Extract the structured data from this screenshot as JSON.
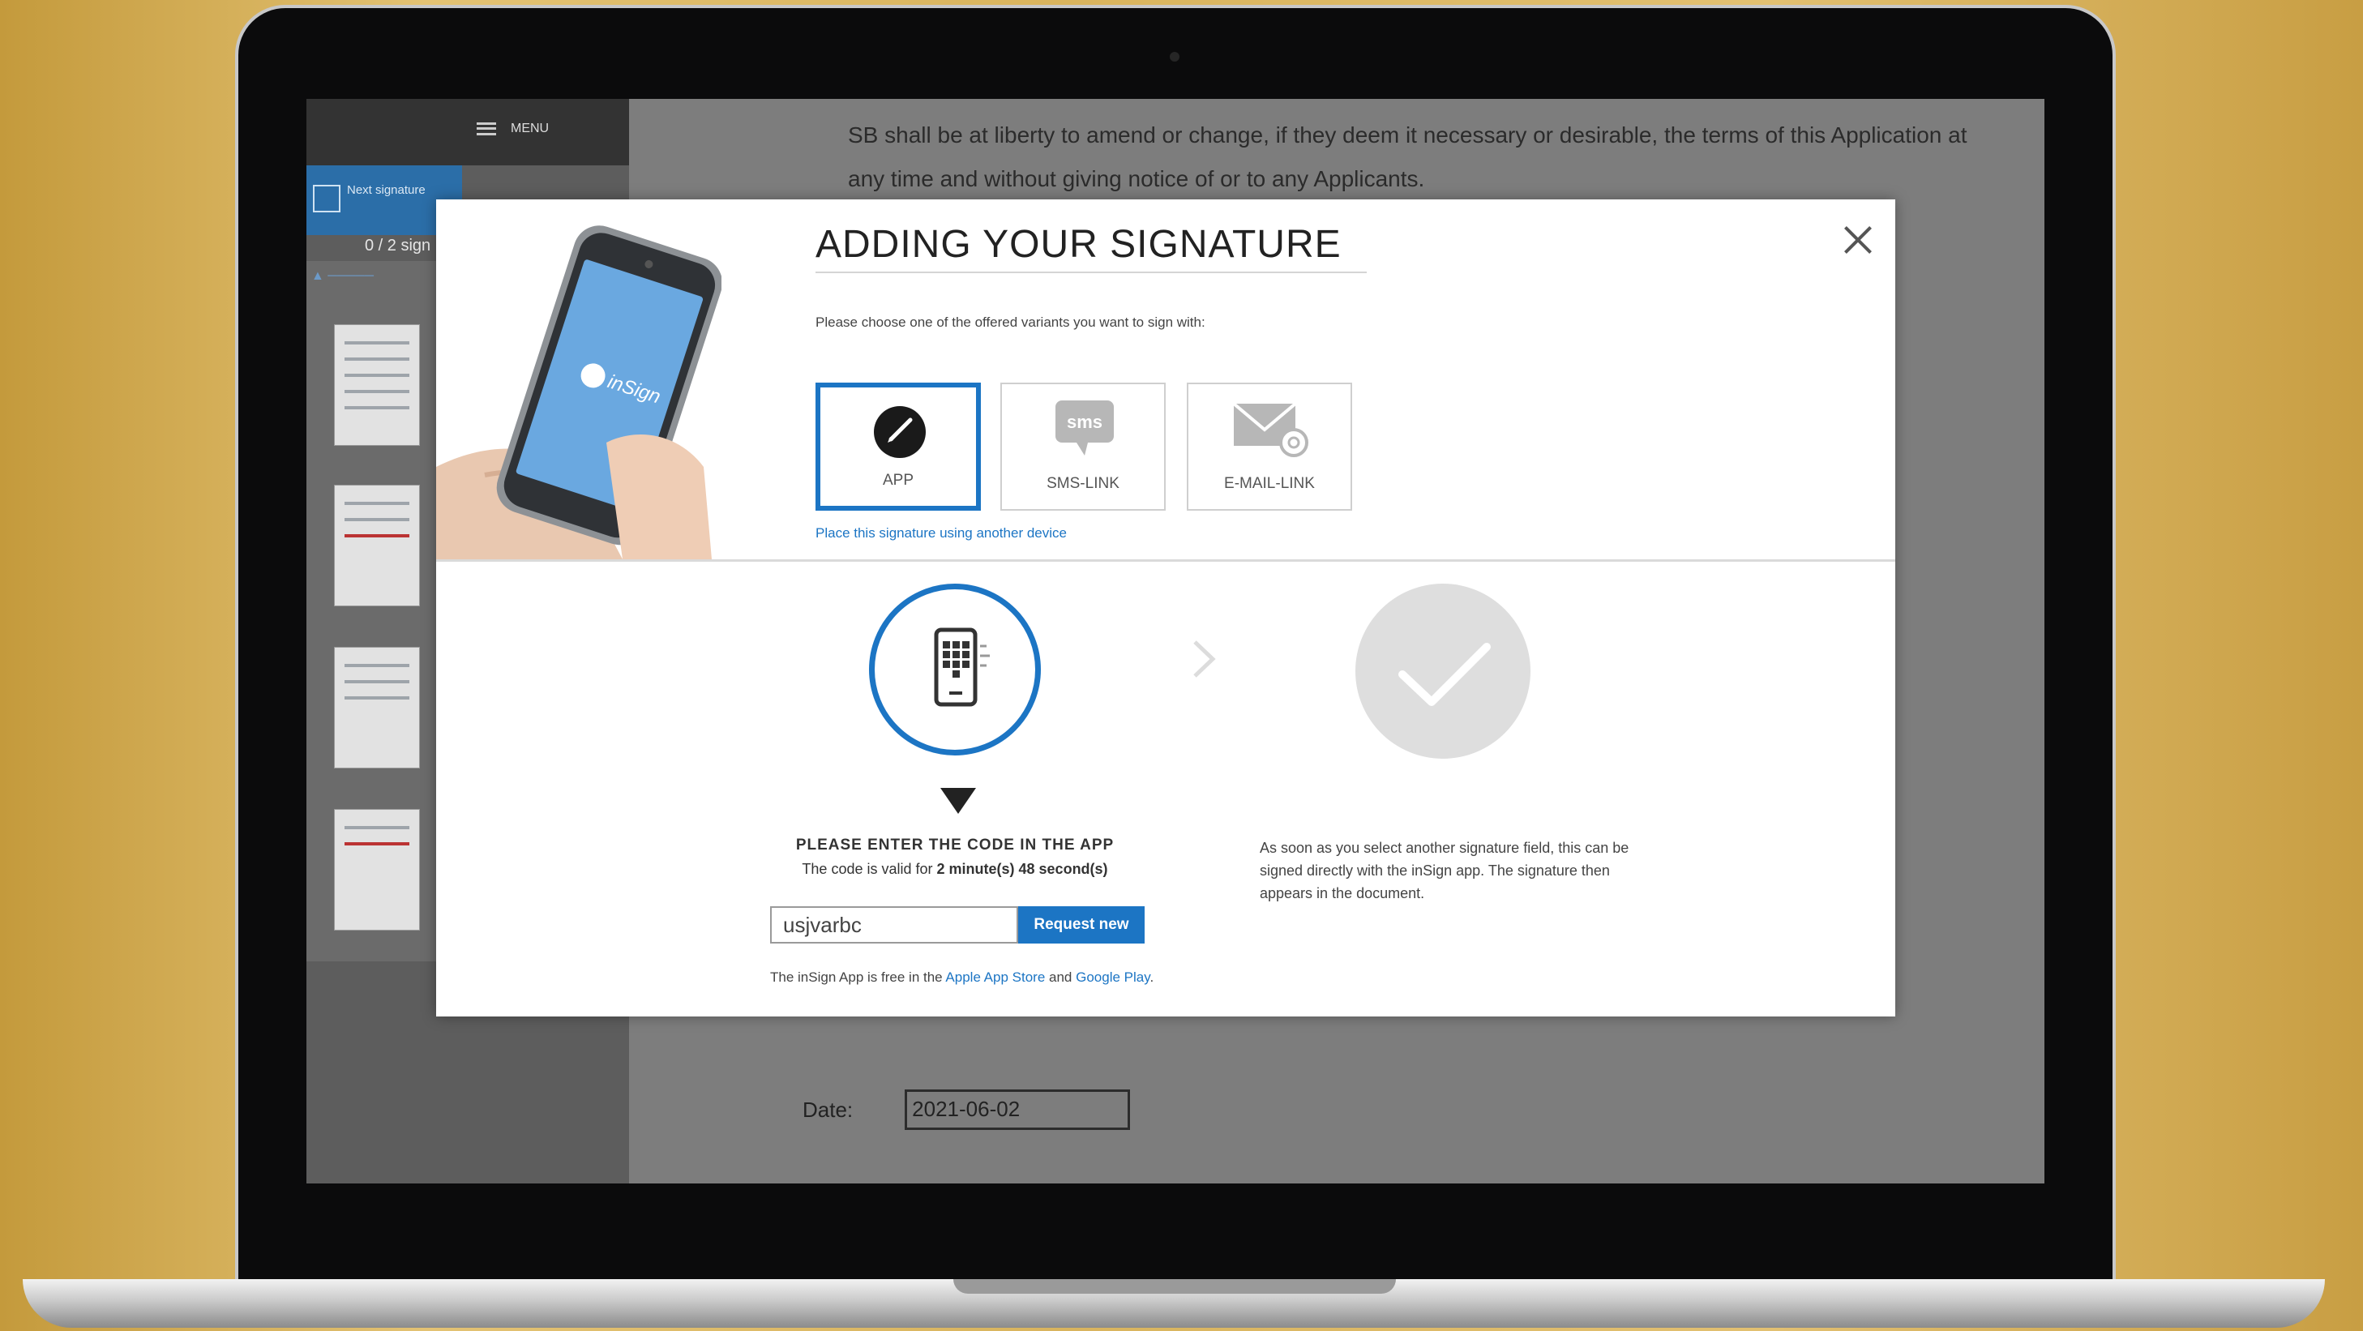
{
  "sidebar": {
    "menu_label": "MENU",
    "next_signature_label": "Next signature",
    "signature_count": "0 / 2 sign"
  },
  "document": {
    "paragraph": "SB shall be at liberty to amend or change, if they deem it necessary or desirable, the terms of this Application at any time and without giving notice of or to any Applicants.",
    "date_label": "Date:",
    "date_value": "2021-06-02"
  },
  "modal": {
    "title": "ADDING YOUR SIGNATURE",
    "instruction": "Please choose one of the offered variants you want to sign with:",
    "options": [
      {
        "label": "APP",
        "icon": "insign-app-icon",
        "selected": true
      },
      {
        "label": "SMS-LINK",
        "icon": "sms-icon",
        "selected": false
      },
      {
        "label": "E-MAIL-LINK",
        "icon": "email-icon",
        "selected": false
      }
    ],
    "other_device_link": "Place this signature using another device",
    "phone_logo": "inSign",
    "enter_code_heading": "PLEASE ENTER THE CODE IN THE APP",
    "valid_prefix": "The code is valid for ",
    "valid_time": "2 minute(s) 48 second(s)",
    "code_value": "usjvarbc",
    "request_new_label": "Request new",
    "free_prefix": "The inSign App is free in the ",
    "apple_link": "Apple App Store",
    "and_text": " and ",
    "google_link": "Google Play",
    "free_suffix": ".",
    "step2_text": "As soon as you select another signature field, this can be signed directly with the inSign app. The signature then appears in the document."
  },
  "colors": {
    "accent": "#1c75c4",
    "background_gold": "#d9b45d",
    "step_done_grey": "#dedede"
  }
}
